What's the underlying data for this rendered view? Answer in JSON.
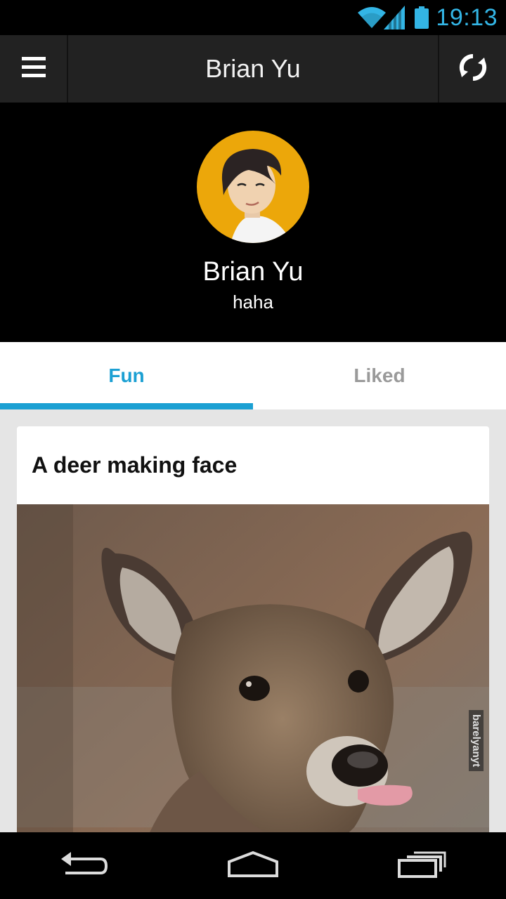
{
  "status_bar": {
    "time": "19:13",
    "icons": [
      "wifi-icon",
      "signal-icon",
      "battery-icon"
    ],
    "accent_color": "#33b5e5"
  },
  "action_bar": {
    "title": "Brian Yu",
    "menu_icon": "hamburger-menu-icon",
    "refresh_icon": "refresh-icon"
  },
  "profile": {
    "name": "Brian Yu",
    "status": "haha",
    "avatar_bg": "#eca70a"
  },
  "tabs": [
    {
      "label": "Fun",
      "active": true
    },
    {
      "label": "Liked",
      "active": false
    }
  ],
  "tab_accent": "#1ca0d3",
  "feed": {
    "cards": [
      {
        "title": "A deer making face",
        "image_icon": "deer-photo",
        "watermark": "barelyanyt"
      }
    ]
  },
  "nav_bar": {
    "buttons": [
      "back-icon",
      "home-icon",
      "recent-apps-icon"
    ]
  }
}
